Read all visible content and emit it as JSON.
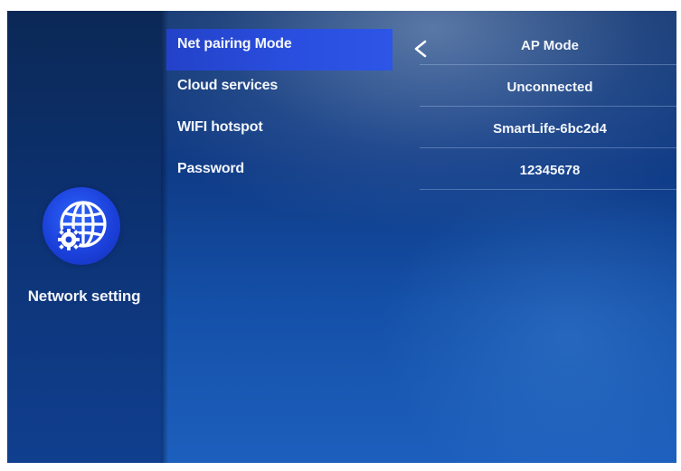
{
  "sidebar": {
    "label": "Network setting",
    "icon": "network-settings-globe-gear-icon"
  },
  "settings": [
    {
      "label": "Net pairing Mode",
      "value": "AP Mode",
      "selected": true
    },
    {
      "label": "Cloud services",
      "value": "Unconnected"
    },
    {
      "label": "WIFI hotspot",
      "value": "SmartLife-6bc2d4"
    },
    {
      "label": "Password",
      "value": "12345678"
    }
  ],
  "colors": {
    "background": "#0f3b86",
    "sidebar": "#0d3375",
    "selected_highlight": "#2a4fe0",
    "icon_circle": "#1a3fd8",
    "text": "#f3f6fb"
  }
}
